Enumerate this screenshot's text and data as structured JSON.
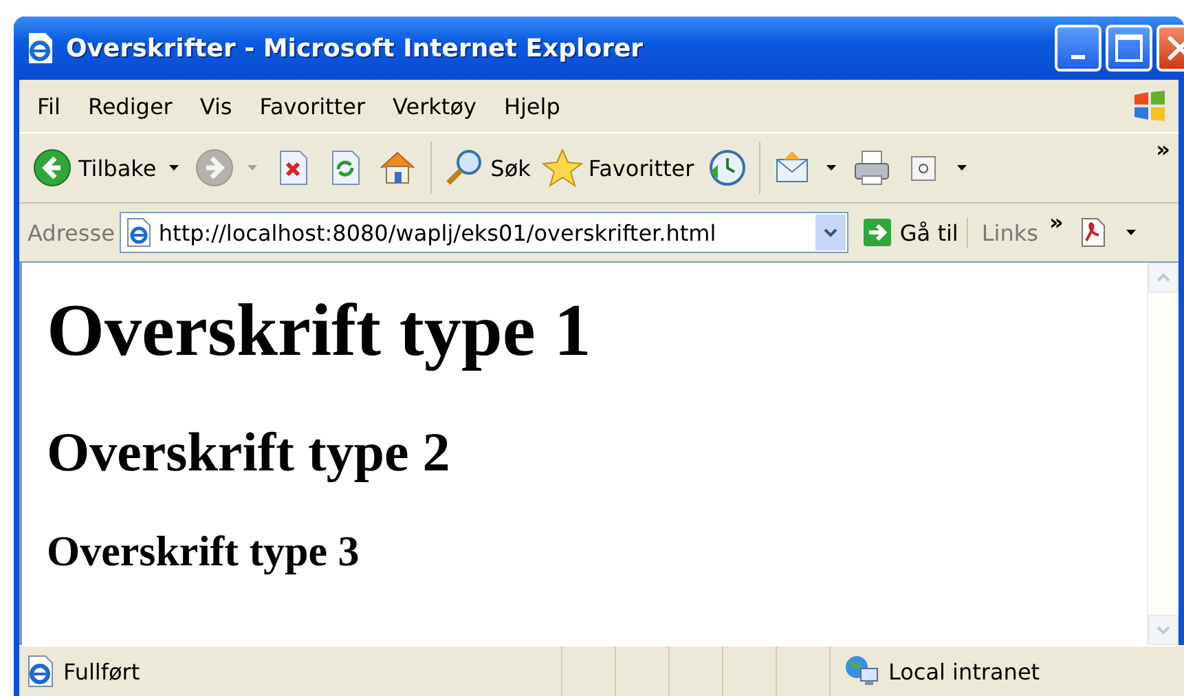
{
  "window": {
    "title": "Overskrifter - Microsoft Internet Explorer"
  },
  "menu": [
    "Fil",
    "Rediger",
    "Vis",
    "Favoritter",
    "Verktøy",
    "Hjelp"
  ],
  "toolbar": {
    "buttons": [
      {
        "kind": "back",
        "label": "Tilbake",
        "disabled": false,
        "dropdown": true
      },
      {
        "kind": "forward",
        "disabled": true,
        "dropdown": true
      },
      {
        "kind": "stop",
        "disabled": false,
        "dropdown": false
      },
      {
        "kind": "refresh",
        "disabled": false,
        "dropdown": false
      },
      {
        "kind": "home",
        "disabled": false,
        "dropdown": false
      },
      {
        "kind": "search",
        "label": "Søk",
        "disabled": false,
        "dropdown": false
      },
      {
        "kind": "favorites",
        "label": "Favoritter",
        "disabled": false,
        "dropdown": false
      },
      {
        "kind": "history",
        "disabled": false,
        "dropdown": false
      },
      {
        "kind": "mail",
        "disabled": false,
        "dropdown": true
      },
      {
        "kind": "print",
        "disabled": false,
        "dropdown": false
      },
      {
        "kind": "edit",
        "disabled": false,
        "dropdown": true
      }
    ],
    "overflow": "»"
  },
  "address": {
    "label": "Adresse",
    "value": "http://localhost:8080/waplj/eks01/overskrifter.html",
    "go": "Gå til",
    "links": "Links",
    "links_overflow": "»"
  },
  "page": {
    "headings": [
      {
        "kind": "h1",
        "text": "Overskrift type 1"
      },
      {
        "kind": "h2",
        "text": "Overskrift type 2"
      },
      {
        "kind": "h3",
        "text": "Overskrift type 3"
      }
    ]
  },
  "status_bar": {
    "text": "Fullført",
    "zone": "Local intranet"
  }
}
